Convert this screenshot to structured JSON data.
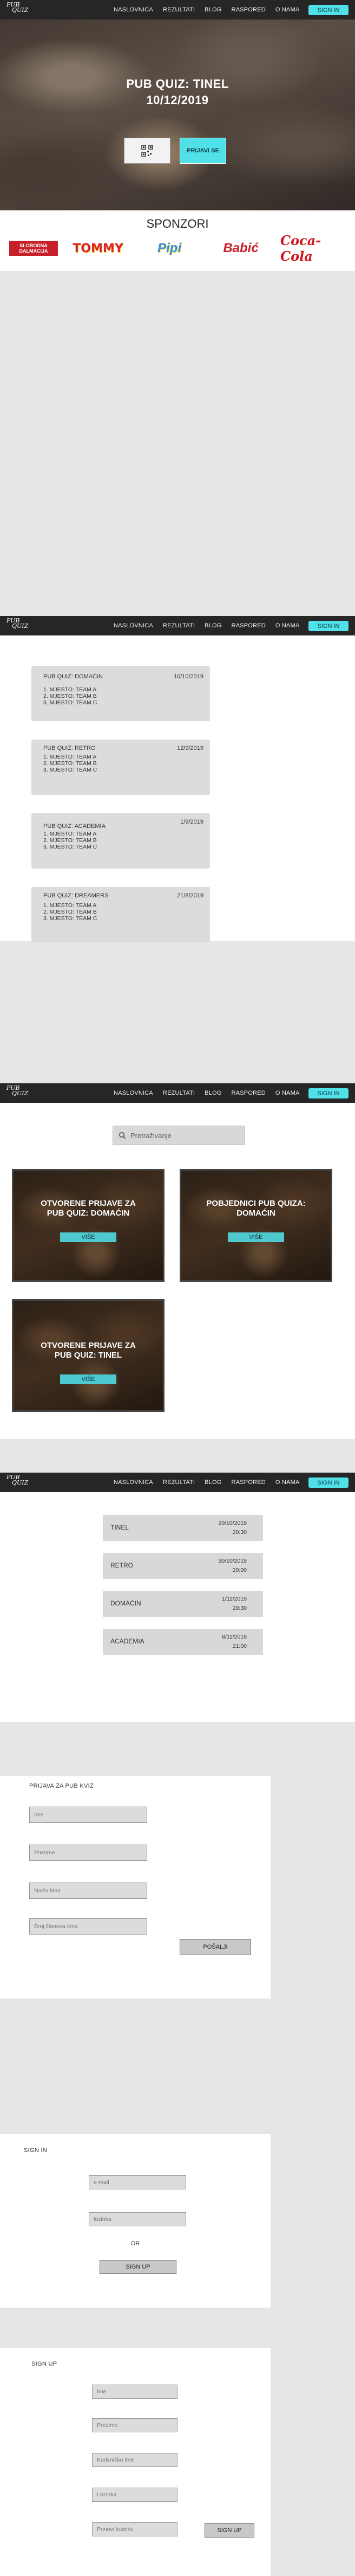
{
  "nav": {
    "logo_line1": "PUB",
    "logo_line2": "QUIZ",
    "links": [
      "NASLOVNICA",
      "REZULTATI",
      "BLOG",
      "RASPORED",
      "O NAMA"
    ],
    "signin": "SIGN IN"
  },
  "hero": {
    "title_line1": "PUB QUIZ: TINEL",
    "title_line2": "10/12/2019",
    "join_button": "PRIJAVI SE",
    "qr_icon": "qr-code-icon"
  },
  "sponsors": {
    "title": "SPONZORI",
    "items": [
      "SLOBODNA DALMACIJA",
      "TOMMY",
      "Pipi",
      "Babić",
      "Coca-Cola"
    ],
    "colors": [
      "#c8202a",
      "#d8262a",
      "#3a8fd6",
      "#c8202a",
      "#d0161c"
    ]
  },
  "results": [
    {
      "title": "PUB QUIZ: DOMAĆIN",
      "date": "10/10/2019",
      "lines": [
        "1. MJESTO:  TEAM A",
        "2. MJESTO:  TEAM B",
        "3. MJESTO:  TEAM C"
      ]
    },
    {
      "title": "PUB QUIZ: RETRO",
      "date": "12/9/2019",
      "lines": [
        "1. MJESTO:  TEAM A",
        "2. MJESTO:  TEAM B",
        "3. MJESTO:  TEAM C"
      ]
    },
    {
      "title": "PUB QUIZ: ACADEMIA",
      "date": "1/9/2019",
      "lines": [
        "1. MJESTO:  TEAM A",
        "2. MJESTO:  TEAM B",
        "3. MJESTO:  TEAM C"
      ]
    },
    {
      "title": "PUB QUIZ: DREAMERS",
      "date": "21/8/2019",
      "lines": [
        "1. MJESTO:  TEAM A",
        "2. MJESTO:  TEAM B",
        "3. MJESTO:  TEAM C"
      ]
    }
  ],
  "blog": {
    "search_placeholder": "Pretraživanje",
    "cards": [
      {
        "title_line1": "OTVORENE PRIJAVE  ZA",
        "title_line2": "PUB QUIZ: DOMAĆIN",
        "button": "VIŠE"
      },
      {
        "title_line1": "POBJEDNICI PUB QUIZA:",
        "title_line2": "DOMAĆIN",
        "button": "VIŠE"
      },
      {
        "title_line1": "OTVORENE PRIJAVE  ZA",
        "title_line2": "PUB QUIZ: TINEL",
        "button": "VIŠE"
      }
    ]
  },
  "schedule": [
    {
      "name": "TINEL",
      "date": "20/10/2019",
      "time": "20:30"
    },
    {
      "name": "RETRO",
      "date": "30/10/2019",
      "time": "20:00"
    },
    {
      "name": "DOMAĆIN",
      "date": "1/11/2019",
      "time": "20:30"
    },
    {
      "name": "ACADEMIA",
      "date": "8/11/2019",
      "time": "21:00"
    }
  ],
  "apply_form": {
    "title": "PRIJAVA ZA PUB KVIZ",
    "fields": [
      "Ime",
      "Prezime",
      "Naziv tima",
      "Broj članova tima"
    ],
    "submit": "POŠALJI"
  },
  "signin_form": {
    "title": "SIGN IN",
    "fields": [
      "e-mail",
      "lozinka"
    ],
    "or": "OR",
    "signup": "SIGN UP"
  },
  "signup_form": {
    "title": "SIGN UP",
    "fields": [
      "Ime",
      "Prezime",
      "Korisničko ime",
      "Lozinka",
      "Ponovi lozinku"
    ],
    "submit": "SIGN UP"
  }
}
